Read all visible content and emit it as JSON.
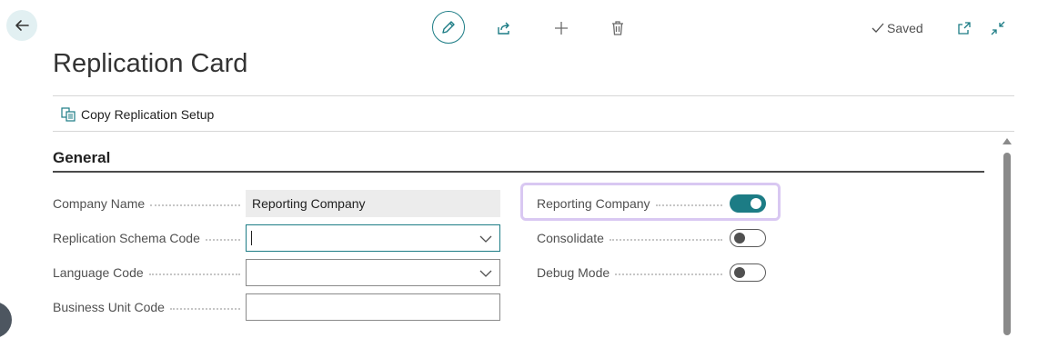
{
  "header": {
    "saved_label": "Saved"
  },
  "page": {
    "title": "Replication Card"
  },
  "actions": {
    "copy_setup_label": "Copy Replication Setup"
  },
  "section": {
    "title": "General"
  },
  "fields_left": [
    {
      "label": "Company Name",
      "value": "Reporting Company"
    },
    {
      "label": "Replication Schema Code",
      "value": ""
    },
    {
      "label": "Language Code",
      "value": ""
    },
    {
      "label": "Business Unit Code",
      "value": ""
    }
  ],
  "fields_right": [
    {
      "label": "Reporting Company",
      "state": "on"
    },
    {
      "label": "Consolidate",
      "state": "off"
    },
    {
      "label": "Debug Mode",
      "state": "off"
    }
  ],
  "colors": {
    "accent": "#1c7c85",
    "highlight": "#d9c8f2"
  },
  "icons": [
    "back-arrow-icon",
    "pencil-icon",
    "share-icon",
    "plus-icon",
    "trash-icon",
    "checkmark-icon",
    "open-in-new-window-icon",
    "collapse-icon",
    "copy-icon",
    "chevron-down-icon",
    "scroll-up-arrow-icon"
  ]
}
